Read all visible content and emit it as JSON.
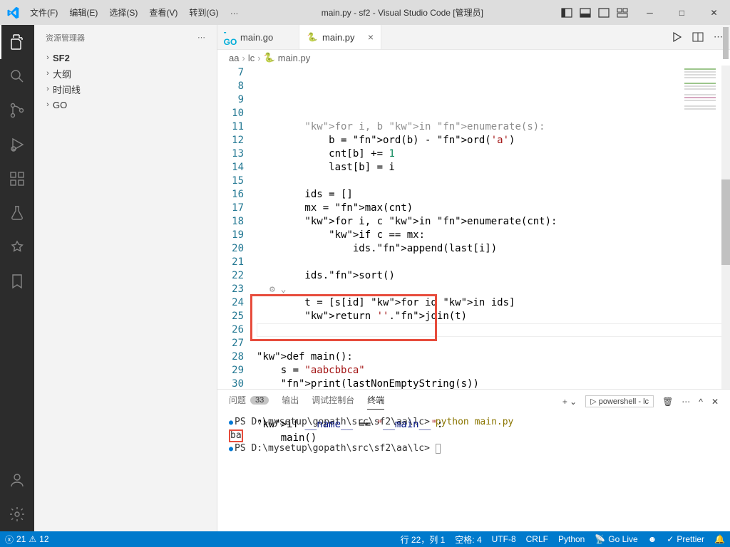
{
  "titlebar": {
    "menus": [
      "文件(F)",
      "编辑(E)",
      "选择(S)",
      "查看(V)",
      "转到(G)",
      "…"
    ],
    "title": "main.py - sf2 - Visual Studio Code [管理员]"
  },
  "sidebar": {
    "header": "资源管理器",
    "items": [
      "SF2",
      "大纲",
      "时间线",
      "GO"
    ]
  },
  "tabs": [
    {
      "icon": "go",
      "label": "main.go",
      "active": false,
      "closable": false
    },
    {
      "icon": "py",
      "label": "main.py",
      "active": true,
      "closable": true
    }
  ],
  "breadcrumb": [
    "aa",
    "lc",
    "main.py"
  ],
  "code": {
    "start": 7,
    "lines": [
      {
        "n": 7,
        "t": "        for i, b in enumerate(s):",
        "faded": true
      },
      {
        "n": 8,
        "t": "            b = ord(b) - ord('a')"
      },
      {
        "n": 9,
        "t": "            cnt[b] += 1"
      },
      {
        "n": 10,
        "t": "            last[b] = i"
      },
      {
        "n": 11,
        "t": ""
      },
      {
        "n": 12,
        "t": "        ids = []"
      },
      {
        "n": 13,
        "t": "        mx = max(cnt)"
      },
      {
        "n": 14,
        "t": "        for i, c in enumerate(cnt):"
      },
      {
        "n": 15,
        "t": "            if c == mx:"
      },
      {
        "n": 16,
        "t": "                ids.append(last[i])"
      },
      {
        "n": 17,
        "t": ""
      },
      {
        "n": 18,
        "t": "        ids.sort()"
      },
      {
        "n": 19,
        "t": ""
      },
      {
        "n": 20,
        "t": "        t = [s[id] for id in ids]"
      },
      {
        "n": 21,
        "t": "        return ''.join(t)"
      },
      {
        "n": 22,
        "t": "",
        "cursor": true
      },
      {
        "n": 23,
        "t": ""
      },
      {
        "n": 24,
        "t": "def main():"
      },
      {
        "n": 25,
        "t": "    s = \"aabcbbca\""
      },
      {
        "n": 26,
        "t": "    print(lastNonEmptyString(s))"
      },
      {
        "n": 27,
        "t": ""
      },
      {
        "n": 28,
        "t": ""
      },
      {
        "n": 29,
        "t": "if __name__ == \"__main__\":"
      },
      {
        "n": 30,
        "t": "    main()"
      }
    ]
  },
  "panel": {
    "tabs": [
      {
        "label": "问题",
        "badge": "33"
      },
      {
        "label": "输出"
      },
      {
        "label": "调试控制台"
      },
      {
        "label": "终端",
        "active": true
      }
    ],
    "profile": "powershell - lc",
    "term": {
      "line1_prompt": "PS D:\\mysetup\\gopath\\src\\sf2\\aa\\lc>",
      "line1_cmd": "python main.py",
      "line2": "ba",
      "line3_prompt": "PS D:\\mysetup\\gopath\\src\\sf2\\aa\\lc>"
    }
  },
  "status": {
    "left": {
      "errors": "21",
      "warnings": "12"
    },
    "right": [
      "行 22，列 1",
      "空格: 4",
      "UTF-8",
      "CRLF",
      "Python",
      "Go Live",
      "Prettier"
    ]
  }
}
